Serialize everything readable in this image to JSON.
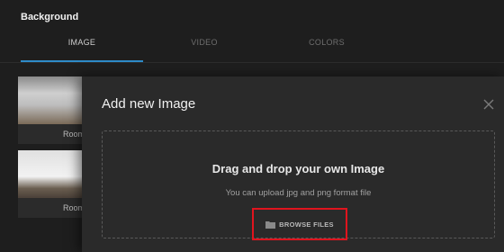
{
  "panel": {
    "title": "Background",
    "tabs": [
      {
        "label": "IMAGE",
        "active": true
      },
      {
        "label": "VIDEO",
        "active": false
      },
      {
        "label": "COLORS",
        "active": false
      }
    ],
    "thumbnails": [
      {
        "caption": "Room"
      },
      {
        "caption": "Room"
      }
    ]
  },
  "modal": {
    "title": "Add new Image",
    "close_icon": "close-icon",
    "dropzone": {
      "title": "Drag and drop your own Image",
      "subtitle": "You can upload jpg and png format file",
      "browse_label": "BROWSE FILES",
      "browse_icon": "folder-icon"
    }
  },
  "colors": {
    "accent": "#2e8bc9",
    "highlight": "#e0141e",
    "modal_bg": "#2a2a2a",
    "panel_bg": "#1e1e1e"
  }
}
